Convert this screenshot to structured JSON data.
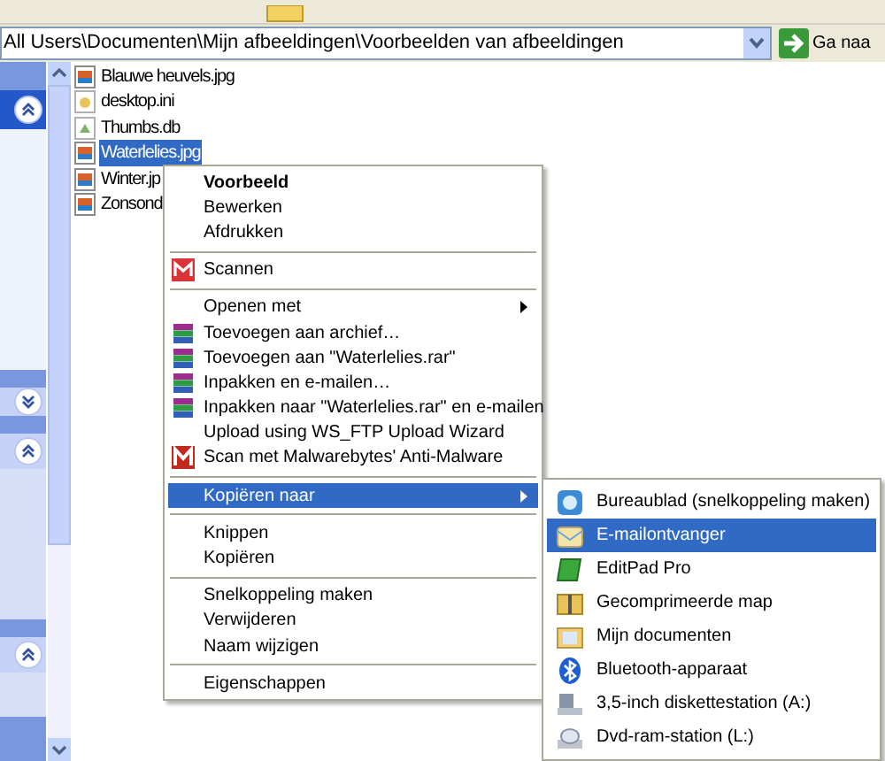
{
  "address_bar": {
    "value": "All Users\\Documenten\\Mijn afbeeldingen\\Voorbeelden van afbeeldingen",
    "go_button": "Ga naa"
  },
  "files": [
    {
      "name": "Blauwe heuvels.jpg",
      "kind": "image",
      "selected": false
    },
    {
      "name": "desktop.ini",
      "kind": "settings",
      "selected": false
    },
    {
      "name": "Thumbs.db",
      "kind": "database",
      "selected": false
    },
    {
      "name": "Waterlelies.jpg",
      "kind": "image",
      "selected": true
    },
    {
      "name": "Winter.jp",
      "kind": "image",
      "selected": false
    },
    {
      "name": "Zonsond",
      "kind": "image",
      "selected": false
    }
  ],
  "context_menu": [
    {
      "kind": "item",
      "label": "Voorbeeld",
      "bold": true,
      "selected": false
    },
    {
      "kind": "item",
      "label": "Bewerken",
      "selected": false
    },
    {
      "kind": "item",
      "label": "Afdrukken",
      "selected": false
    },
    {
      "kind": "separator"
    },
    {
      "kind": "item",
      "label": "Scannen",
      "selected": false
    },
    {
      "kind": "separator"
    },
    {
      "kind": "item",
      "label": "Openen met",
      "submenu": true,
      "selected": false
    },
    {
      "kind": "item",
      "label": "Toevoegen aan archief…",
      "selected": false
    },
    {
      "kind": "item",
      "label": "Toevoegen aan \"Waterlelies.rar\"",
      "selected": false
    },
    {
      "kind": "item",
      "label": "Inpakken en e-mailen…",
      "selected": false
    },
    {
      "kind": "item",
      "label": "Inpakken naar \"Waterlelies.rar\" en e-mailen",
      "selected": false
    },
    {
      "kind": "item",
      "label": "Upload using WS_FTP Upload Wizard",
      "selected": false
    },
    {
      "kind": "item",
      "label": "Scan met Malwarebytes' Anti-Malware",
      "selected": false
    },
    {
      "kind": "separator"
    },
    {
      "kind": "item",
      "label": "Kopiëren naar",
      "submenu": true,
      "selected": true
    },
    {
      "kind": "separator"
    },
    {
      "kind": "item",
      "label": "Knippen",
      "selected": false
    },
    {
      "kind": "item",
      "label": "Kopiëren",
      "selected": false
    },
    {
      "kind": "separator"
    },
    {
      "kind": "item",
      "label": "Snelkoppeling maken",
      "selected": false
    },
    {
      "kind": "item",
      "label": "Verwijderen",
      "selected": false
    },
    {
      "kind": "item",
      "label": "Naam wijzigen",
      "selected": false
    },
    {
      "kind": "separator"
    },
    {
      "kind": "item",
      "label": "Eigenschappen",
      "selected": false
    }
  ],
  "submenu": [
    {
      "label": "Bureaublad (snelkoppeling maken)",
      "selected": false
    },
    {
      "label": "E-mailontvanger",
      "selected": true
    },
    {
      "label": "EditPad Pro",
      "selected": false
    },
    {
      "label": "Gecomprimeerde map",
      "selected": false
    },
    {
      "label": "Mijn documenten",
      "selected": false
    },
    {
      "label": "Bluetooth-apparaat",
      "selected": false
    },
    {
      "label": "3,5-inch diskettestation (A:)",
      "selected": false
    },
    {
      "label": "Dvd-ram-station (L:)",
      "selected": false
    }
  ]
}
